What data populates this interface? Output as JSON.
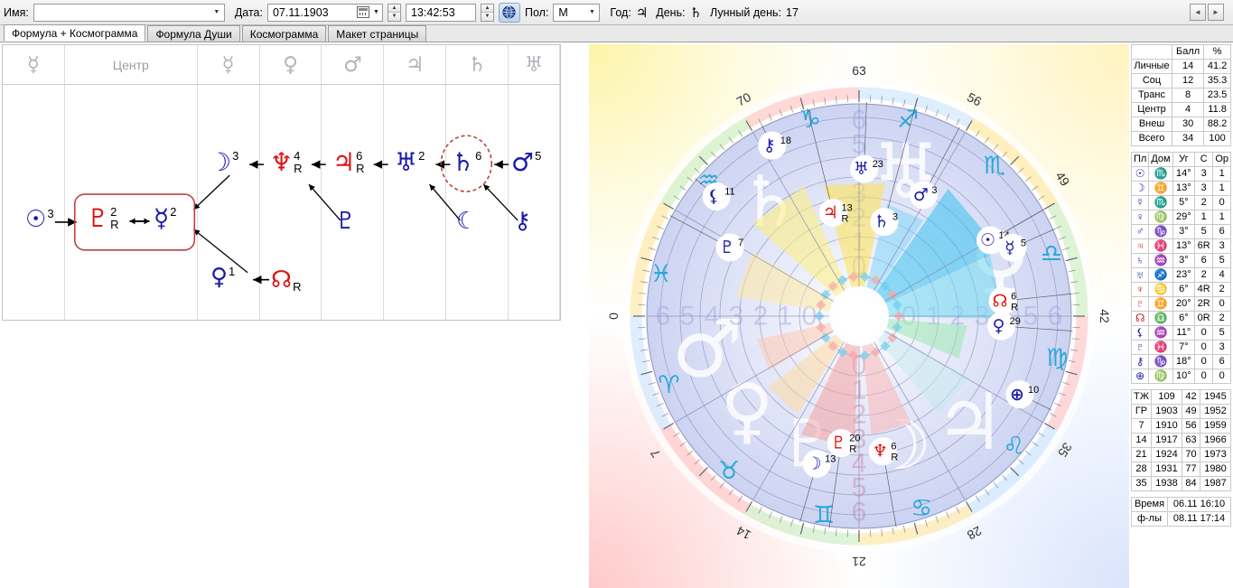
{
  "toolbar": {
    "name_label": "Имя:",
    "name_value": "",
    "date_label": "Дата:",
    "date_value": "07.11.1903",
    "time_value": "13:42:53",
    "gender_label": "Пол:",
    "gender_value": "М",
    "year_label": "Год:",
    "year_symbol": "♃",
    "day_label": "День:",
    "day_symbol": "♄",
    "lunar_label": "Лунный день:",
    "lunar_value": "17",
    "calendar_icon": "calendar-icon",
    "globe_icon": "globe-icon",
    "prev_icon": "◄",
    "next_icon": "►"
  },
  "tabs": [
    {
      "label": "Формула + Космограмма",
      "active": true
    },
    {
      "label": "Формула Души",
      "active": false
    },
    {
      "label": "Космограмма",
      "active": false
    },
    {
      "label": "Макет страницы",
      "active": false
    }
  ],
  "formula": {
    "columns": [
      {
        "symbol": "☿",
        "type": "glyph"
      },
      {
        "symbol": "Центр",
        "type": "text"
      },
      {
        "symbol": "☿",
        "type": "glyph"
      },
      {
        "symbol": "♀",
        "type": "glyph"
      },
      {
        "symbol": "♂",
        "type": "glyph"
      },
      {
        "symbol": "♃",
        "type": "glyph"
      },
      {
        "symbol": "♄",
        "type": "glyph"
      },
      {
        "symbol": "♅",
        "type": "glyph"
      }
    ],
    "chain_top": [
      {
        "glyph": "☽",
        "num": "3",
        "retro": "",
        "color": "#1a1aaa",
        "name": "moon"
      },
      {
        "glyph": "♆",
        "num": "4",
        "retro": "R",
        "color": "#dd1111",
        "name": "neptune"
      },
      {
        "glyph": "♃",
        "num": "6",
        "retro": "R",
        "color": "#dd1111",
        "name": "jupiter"
      },
      {
        "glyph": "♅",
        "num": "2",
        "retro": "",
        "color": "#1a1aaa",
        "name": "uranus"
      },
      {
        "glyph": "♄",
        "num": "6",
        "retro": "",
        "color": "#1a1aaa",
        "name": "saturn"
      },
      {
        "glyph": "♂",
        "num": "5",
        "retro": "",
        "color": "#1a1aaa",
        "name": "mars"
      }
    ],
    "sun": {
      "glyph": "☉",
      "num": "3",
      "color": "#1a1aaa"
    },
    "center_pair": [
      {
        "glyph": "♇",
        "num": "2",
        "retro": "R",
        "color": "#dd1111",
        "name": "pluto"
      },
      {
        "glyph": "☿",
        "num": "2",
        "retro": "",
        "color": "#1a1aaa",
        "name": "mercury"
      }
    ],
    "venus_row": [
      {
        "glyph": "♀",
        "num": "1",
        "retro": "",
        "color": "#1a1aaa",
        "name": "venus"
      },
      {
        "glyph": "☊",
        "num": "",
        "retro": "R",
        "color": "#dd1111",
        "name": "north-node"
      }
    ],
    "leaves": [
      {
        "glyph": "♇",
        "color": "#1a1aaa",
        "name": "pluto-leaf"
      },
      {
        "glyph": "☾",
        "color": "#1a1aaa",
        "name": "lilith-leaf"
      },
      {
        "glyph": "⚷",
        "color": "#1a1aaa",
        "name": "chiron-leaf"
      }
    ]
  },
  "chart": {
    "zodiac_signs": [
      {
        "symbol": "♑",
        "name": "capricorn"
      },
      {
        "symbol": "♐",
        "name": "sagittarius"
      },
      {
        "symbol": "♏",
        "name": "scorpio"
      },
      {
        "symbol": "♎",
        "name": "libra"
      },
      {
        "symbol": "♍",
        "name": "virgo"
      },
      {
        "symbol": "♌",
        "name": "leo"
      },
      {
        "symbol": "♋",
        "name": "cancer"
      },
      {
        "symbol": "♊",
        "name": "gemini"
      },
      {
        "symbol": "♉",
        "name": "taurus"
      },
      {
        "symbol": "♈",
        "name": "aries"
      },
      {
        "symbol": "♓",
        "name": "pisces"
      },
      {
        "symbol": "♒",
        "name": "aquarius"
      }
    ],
    "age_marks": [
      {
        "value": "63",
        "angle": -90
      },
      {
        "value": "70",
        "angle": -118
      },
      {
        "value": "56",
        "angle": -62
      },
      {
        "value": "49",
        "angle": -34
      },
      {
        "value": "42",
        "angle": 0
      },
      {
        "value": "35",
        "angle": 33
      },
      {
        "value": "28",
        "angle": 62
      },
      {
        "value": "21",
        "angle": 90
      },
      {
        "value": "14",
        "angle": 118
      },
      {
        "value": "7",
        "angle": 146
      },
      {
        "value": "0",
        "angle": 180
      }
    ],
    "planet_markers": [
      {
        "glyph": "⚷",
        "num": "18",
        "retro": "",
        "color": "#1a1aaa",
        "name": "chiron-marker"
      },
      {
        "glyph": "♅",
        "num": "23",
        "retro": "",
        "color": "#1a1aaa",
        "name": "uranus-marker"
      },
      {
        "glyph": "⚸",
        "num": "11",
        "retro": "",
        "color": "#1a1aaa",
        "name": "lilith-marker"
      },
      {
        "glyph": "♇",
        "num": "7",
        "retro": "",
        "color": "#1a1aaa",
        "name": "proserpina-marker"
      },
      {
        "glyph": "♄",
        "num": "3",
        "retro": "",
        "color": "#1a1aaa",
        "name": "saturn-marker"
      },
      {
        "glyph": "♂",
        "num": "3",
        "retro": "",
        "color": "#1a1aaa",
        "name": "mars-marker"
      },
      {
        "glyph": "♃",
        "num": "13",
        "retro": "R",
        "color": "#dd1111",
        "name": "jupiter-marker"
      },
      {
        "glyph": "☉",
        "num": "14",
        "retro": "",
        "color": "#1a1aaa",
        "name": "sun-marker"
      },
      {
        "glyph": "☿",
        "num": "5",
        "retro": "",
        "color": "#1a1aaa",
        "name": "mercury-marker"
      },
      {
        "glyph": "☊",
        "num": "6",
        "retro": "R",
        "color": "#dd1111",
        "name": "node-marker"
      },
      {
        "glyph": "♀",
        "num": "29",
        "retro": "",
        "color": "#1a1aaa",
        "name": "venus-marker"
      },
      {
        "glyph": "⊕",
        "num": "10",
        "retro": "",
        "color": "#1a1aaa",
        "name": "selena-marker"
      },
      {
        "glyph": "♆",
        "num": "6",
        "retro": "R",
        "color": "#dd1111",
        "name": "neptune-marker"
      },
      {
        "glyph": "♇",
        "num": "20",
        "retro": "R",
        "color": "#dd1111",
        "name": "pluto-marker"
      },
      {
        "glyph": "☽",
        "num": "13",
        "retro": "",
        "color": "#1a1aaa",
        "name": "moon-marker"
      }
    ],
    "inner_numbers": [
      "0",
      "1",
      "2",
      "3",
      "4",
      "5",
      "6"
    ]
  },
  "score_table": {
    "headers": [
      "",
      "Балл",
      "%"
    ],
    "rows": [
      {
        "label": "Личные",
        "score": "14",
        "pct": "41.2"
      },
      {
        "label": "Соц",
        "score": "12",
        "pct": "35.3"
      },
      {
        "label": "Транс",
        "score": "8",
        "pct": "23.5"
      },
      {
        "label": "Центр",
        "score": "4",
        "pct": "11.8"
      },
      {
        "label": "Внеш",
        "score": "30",
        "pct": "88.2"
      },
      {
        "label": "Всего",
        "score": "34",
        "pct": "100"
      }
    ]
  },
  "positions_table": {
    "headers": [
      "Пл",
      "Дом",
      "Уг",
      "С",
      "Ор"
    ],
    "rows": [
      {
        "planet": "☉",
        "color": "#2222aa",
        "sign": "♏",
        "deg": "14°",
        "c": "3",
        "or": "1"
      },
      {
        "planet": "☽",
        "color": "#2222aa",
        "sign": "♊",
        "deg": "13°",
        "c": "3",
        "or": "1"
      },
      {
        "planet": "☿",
        "color": "#2222aa",
        "sign": "♏",
        "deg": "5°",
        "c": "2",
        "or": "0"
      },
      {
        "planet": "♀",
        "color": "#2222aa",
        "sign": "♍",
        "deg": "29°",
        "c": "1",
        "or": "1"
      },
      {
        "planet": "♂",
        "color": "#2222aa",
        "sign": "♑",
        "deg": "3°",
        "c": "5",
        "or": "6"
      },
      {
        "planet": "♃",
        "color": "#cc2222",
        "sign": "♓",
        "deg": "13°",
        "c": "6R",
        "or": "3"
      },
      {
        "planet": "♄",
        "color": "#2222aa",
        "sign": "♒",
        "deg": "3°",
        "c": "6",
        "or": "5"
      },
      {
        "planet": "♅",
        "color": "#2222aa",
        "sign": "♐",
        "deg": "23°",
        "c": "2",
        "or": "4"
      },
      {
        "planet": "♆",
        "color": "#cc2222",
        "sign": "♋",
        "deg": "6°",
        "c": "4R",
        "or": "2"
      },
      {
        "planet": "♇",
        "color": "#cc2222",
        "sign": "♊",
        "deg": "20°",
        "c": "2R",
        "or": "0"
      },
      {
        "planet": "☊",
        "color": "#cc2222",
        "sign": "♎",
        "deg": "6°",
        "c": "0R",
        "or": "2"
      },
      {
        "planet": "⚸",
        "color": "#2222aa",
        "sign": "♒",
        "deg": "11°",
        "c": "0",
        "or": "5"
      },
      {
        "planet": "♇",
        "color": "#2222aa",
        "sign": "♓",
        "deg": "7°",
        "c": "0",
        "or": "3"
      },
      {
        "planet": "⚷",
        "color": "#2222aa",
        "sign": "♑",
        "deg": "18°",
        "c": "0",
        "or": "6"
      },
      {
        "planet": "⊕",
        "color": "#2222aa",
        "sign": "♍",
        "deg": "10°",
        "c": "0",
        "or": "0"
      }
    ]
  },
  "years_table": {
    "rows": [
      {
        "age": "ТЖ",
        "y1": "109",
        "age2": "42",
        "y2": "1945"
      },
      {
        "age": "ГР",
        "y1": "1903",
        "age2": "49",
        "y2": "1952"
      },
      {
        "age": "7",
        "y1": "1910",
        "age2": "56",
        "y2": "1959"
      },
      {
        "age": "14",
        "y1": "1917",
        "age2": "63",
        "y2": "1966"
      },
      {
        "age": "21",
        "y1": "1924",
        "age2": "70",
        "y2": "1973"
      },
      {
        "age": "28",
        "y1": "1931",
        "age2": "77",
        "y2": "1980"
      },
      {
        "age": "35",
        "y1": "1938",
        "age2": "84",
        "y2": "1987"
      }
    ]
  },
  "time_table": {
    "rows": [
      {
        "label": "Время",
        "value": "06.11 16:10"
      },
      {
        "label": "ф-лы",
        "value": "08.11 17:14"
      }
    ]
  }
}
